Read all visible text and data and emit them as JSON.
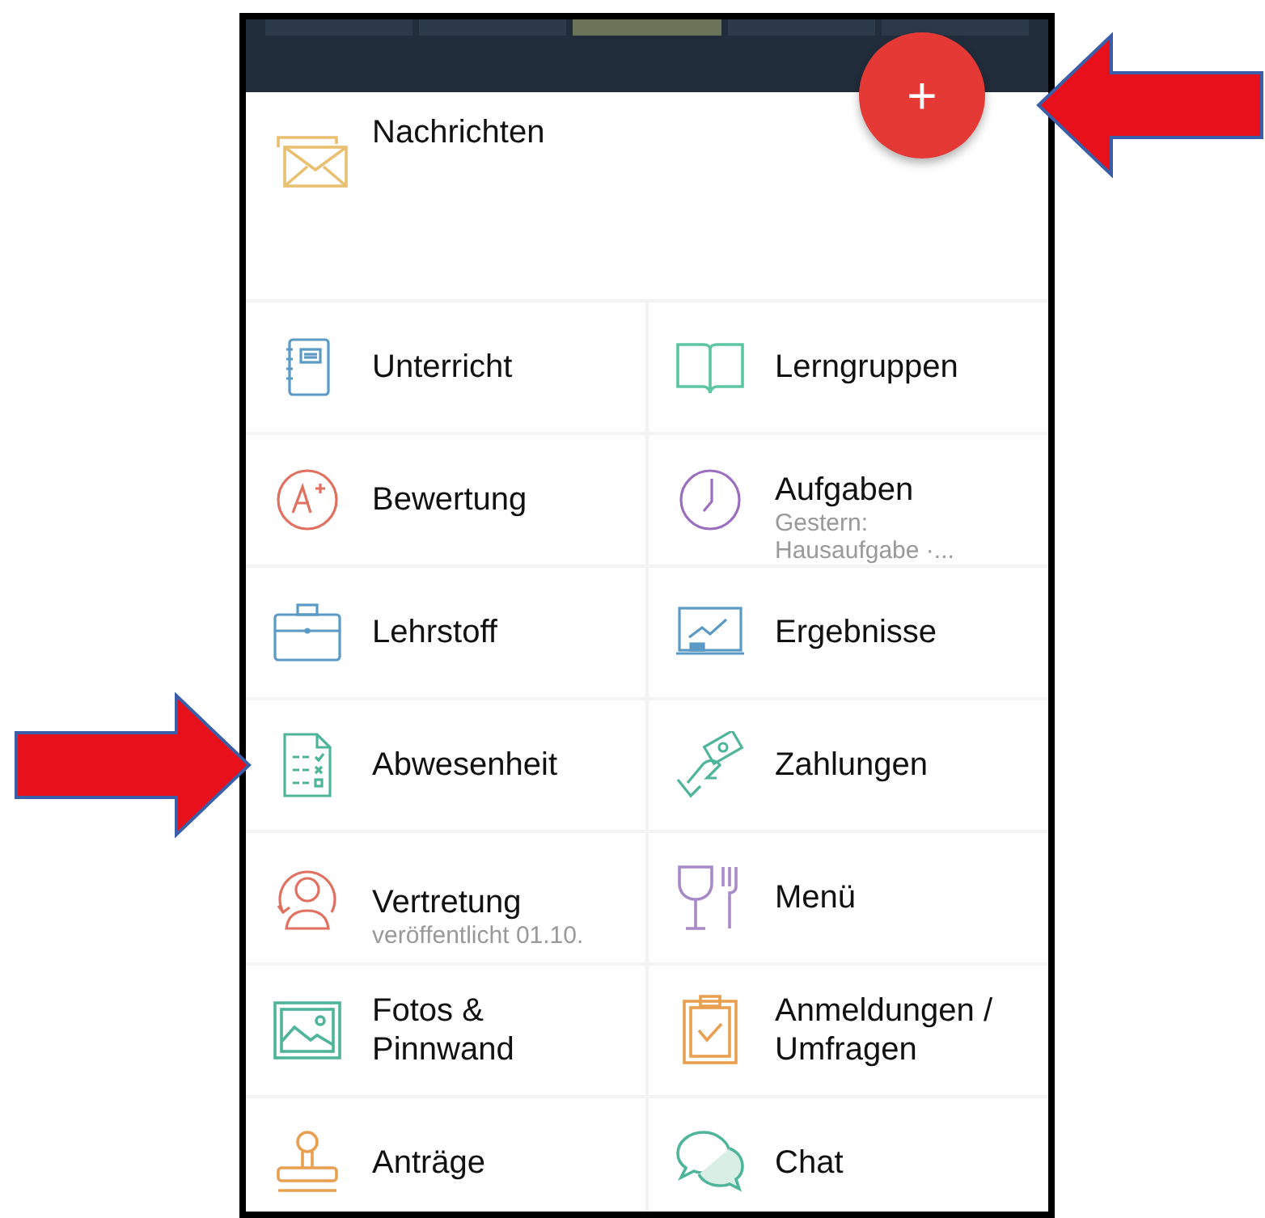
{
  "timeline": [
    {
      "selected": false
    },
    {
      "selected": false
    },
    {
      "selected": true
    },
    {
      "selected": false
    },
    {
      "selected": false
    }
  ],
  "fab": {
    "label": "+"
  },
  "messages": {
    "title": "Nachrichten"
  },
  "tiles": [
    {
      "title": "Unterricht"
    },
    {
      "title": "Lerngruppen"
    },
    {
      "title": "Bewertung"
    },
    {
      "title": "Aufgaben",
      "subtitle": "Gestern: Hausaufgabe ·..."
    },
    {
      "title": "Lehrstoff"
    },
    {
      "title": "Ergebnisse"
    },
    {
      "title": "Abwesenheit"
    },
    {
      "title": "Zahlungen"
    },
    {
      "title": "Vertretung",
      "subtitle": "veröffentlicht 01.10."
    },
    {
      "title": "Menü"
    },
    {
      "title": "Fotos & Pinnwand"
    },
    {
      "title": "Anmeldungen / Umfragen"
    },
    {
      "title": "Anträge"
    },
    {
      "title": "Chat"
    }
  ]
}
